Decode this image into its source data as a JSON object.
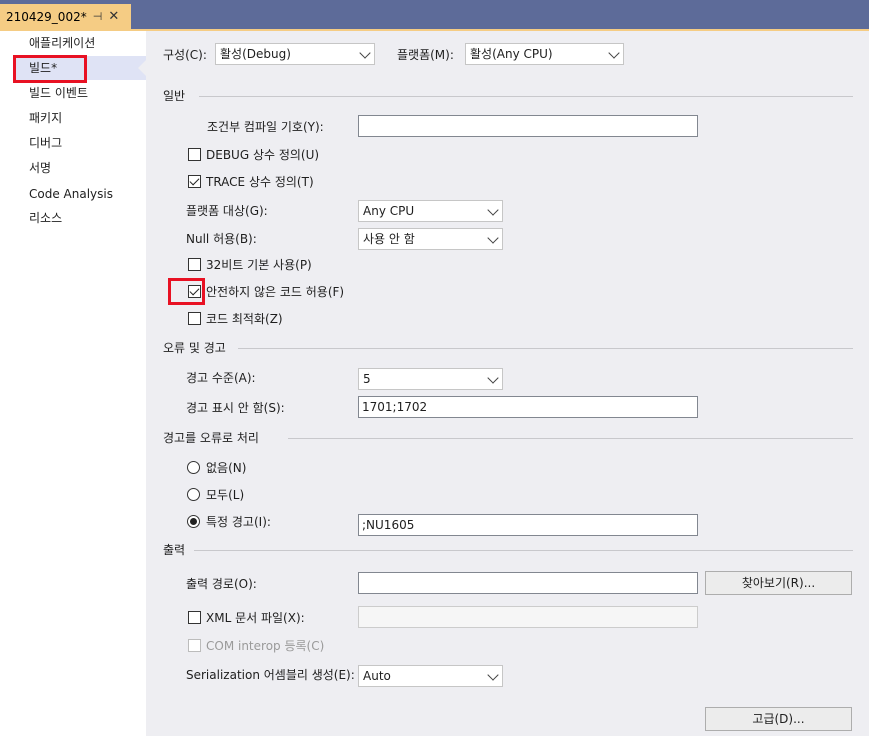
{
  "tab": {
    "title": "210429_002*",
    "pin_icon": "pin-icon",
    "close_icon": "close-icon"
  },
  "sidebar": {
    "items": [
      {
        "label": "애플리케이션"
      },
      {
        "label": "빌드*"
      },
      {
        "label": "빌드 이벤트"
      },
      {
        "label": "패키지"
      },
      {
        "label": "디버그"
      },
      {
        "label": "서명"
      },
      {
        "label": "Code Analysis"
      },
      {
        "label": "리소스"
      }
    ],
    "selected_index": 1
  },
  "toolbar": {
    "config_label": "구성(C):",
    "config_value": "활성(Debug)",
    "platform_label": "플랫폼(M):",
    "platform_value": "활성(Any CPU)"
  },
  "general": {
    "title": "일반",
    "symbols_label": "조건부 컴파일 기호(Y):",
    "symbols_value": "",
    "debug_label": "DEBUG 상수 정의(U)",
    "debug_checked": false,
    "trace_label": "TRACE 상수 정의(T)",
    "trace_checked": true,
    "platform_target_label": "플랫폼 대상(G):",
    "platform_target_value": "Any CPU",
    "nullable_label": "Null 허용(B):",
    "nullable_value": "사용 안 함",
    "prefer32_label": "32비트 기본 사용(P)",
    "prefer32_checked": false,
    "unsafe_label": "안전하지 않은 코드 허용(F)",
    "unsafe_checked": true,
    "optimize_label": "코드 최적화(Z)",
    "optimize_checked": false
  },
  "errors": {
    "title": "오류 및 경고",
    "warning_level_label": "경고 수준(A):",
    "warning_level_value": "5",
    "suppress_label": "경고 표시 안 함(S):",
    "suppress_value": "1701;1702"
  },
  "treat": {
    "title": "경고를 오류로 처리",
    "none_label": "없음(N)",
    "all_label": "모두(L)",
    "specific_label": "특정 경고(I):",
    "specific_value": ";NU1605",
    "selected": "specific"
  },
  "output": {
    "title": "출력",
    "path_label": "출력 경로(O):",
    "path_value": "",
    "browse_label": "찾아보기(R)...",
    "xml_label": "XML 문서 파일(X):",
    "xml_checked": false,
    "xml_value": "",
    "com_label": "COM interop 등록(C)",
    "com_checked": false,
    "serialization_label": "Serialization 어셈블리 생성(E):",
    "serialization_value": "Auto",
    "advanced_label": "고급(D)..."
  },
  "colors": {
    "tab_accent": "#f5cc84",
    "highlight": "#e81123",
    "selection": "#dfe3f5"
  }
}
